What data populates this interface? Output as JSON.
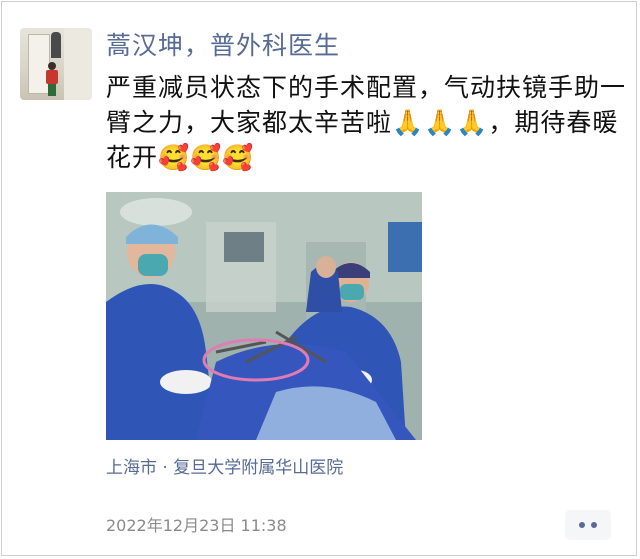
{
  "post": {
    "author_name": "蒿汉坤，普外科医生",
    "content": "严重减员状态下的手术配置，气动扶镜手助一臂之力，大家都太辛苦啦🙏🙏🙏，期待春暖花开🥰🥰🥰",
    "location": "上海市 · 复旦大学附属华山医院",
    "timestamp": "2022年12月23日 11:38"
  },
  "icons": {
    "more": "more-dots-icon"
  },
  "colors": {
    "name_link": "#576b95",
    "text": "#111111",
    "timestamp": "#8a8a8a"
  }
}
